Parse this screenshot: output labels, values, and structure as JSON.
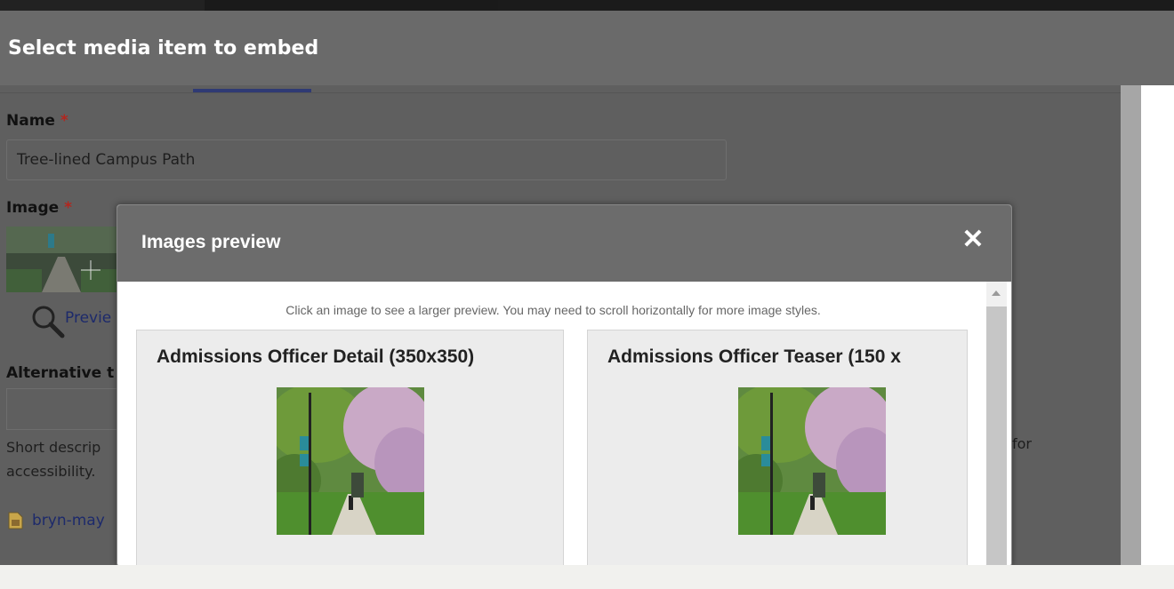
{
  "dialog": {
    "title": "Select media item to embed"
  },
  "form": {
    "name_label": "Name",
    "required_mark": "*",
    "name_value": "Tree-lined Campus Path",
    "image_label": "Image",
    "preview_link": "Previe",
    "alt_label": "Alternative t",
    "alt_value": "",
    "description_line1": "Short descrip",
    "description_line2": "accessibility.",
    "description_tail": "for",
    "file_link": "bryn-may"
  },
  "modal": {
    "title": "Images preview",
    "close_glyph": "✕",
    "hint": "Click an image to see a larger preview. You may need to scroll horizontally for more image styles.",
    "cards": [
      {
        "title": "Admissions Officer Detail (350x350)"
      },
      {
        "title": "Admissions Officer Teaser (150 x"
      }
    ]
  },
  "colors": {
    "overlay": "#5f5f5f",
    "header": "#6a6a6a",
    "required": "#b3261e",
    "link": "#1d2a6b"
  },
  "icons": [
    "search-icon",
    "file-image-icon",
    "close-icon"
  ]
}
